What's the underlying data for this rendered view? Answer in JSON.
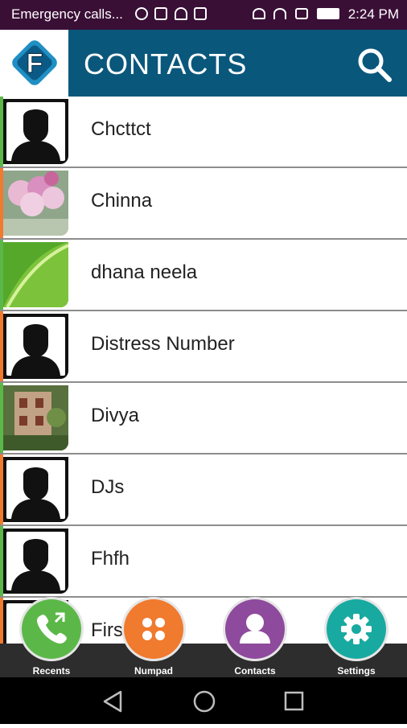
{
  "status_bar": {
    "carrier_text": "Emergency calls...",
    "time": "2:24 PM"
  },
  "app_bar": {
    "logo_letter": "F",
    "title": "CONTACTS",
    "search_icon": "search-icon"
  },
  "contacts": [
    {
      "name": "Chcttct",
      "accent": "#5bb848",
      "avatar": "default"
    },
    {
      "name": "Chinna",
      "accent": "#f07a2d",
      "avatar": "photo-flowers"
    },
    {
      "name": "dhana neela",
      "accent": "#5bb848",
      "avatar": "photo-leaf"
    },
    {
      "name": "Distress Number",
      "accent": "#f07a2d",
      "avatar": "default"
    },
    {
      "name": "Divya",
      "accent": "#5bb848",
      "avatar": "photo-house"
    },
    {
      "name": "DJs",
      "accent": "#f07a2d",
      "avatar": "default"
    },
    {
      "name": "Fhfh",
      "accent": "#5bb848",
      "avatar": "default"
    },
    {
      "name": "Firs",
      "accent": "#f07a2d",
      "avatar": "default"
    }
  ],
  "bottom_nav": [
    {
      "label": "Recents",
      "color": "#5bb848",
      "icon": "phone-icon"
    },
    {
      "label": "Numpad",
      "color": "#f07a2d",
      "icon": "dialpad-icon"
    },
    {
      "label": "Contacts",
      "color": "#8e4a9c",
      "icon": "person-icon"
    },
    {
      "label": "Settings",
      "color": "#18aaa0",
      "icon": "gear-icon"
    }
  ]
}
